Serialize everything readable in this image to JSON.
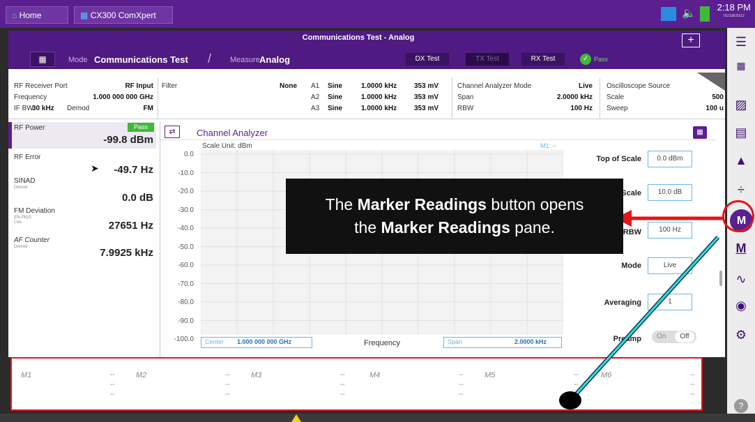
{
  "taskbar": {
    "home": "Home",
    "app": "CX300 ComXpert",
    "time": "2:18 PM",
    "date": "01/18/2022"
  },
  "header": {
    "title": "Communications Test - Analog",
    "mode_label": "Mode",
    "mode_value": "Communications Test",
    "measure_label": "Measure",
    "measure_value": "Analog",
    "tests": [
      "DX Test",
      "TX Test",
      "RX Test"
    ],
    "status": "Pass"
  },
  "info": {
    "rf_port_label": "RF Receiver Port",
    "rf_port_value": "RF Input",
    "freq_label": "Frequency",
    "freq_value": "1.000 000 000 GHz",
    "ifbw_label": "IF BW",
    "ifbw_value": "30 kHz",
    "demod_label": "Demod",
    "demod_value": "FM",
    "filter_label": "Filter",
    "filter_value": "None",
    "audio": [
      {
        "name": "A1",
        "wave": "Sine",
        "freq": "1.0000 kHz",
        "level": "353 mV"
      },
      {
        "name": "A2",
        "wave": "Sine",
        "freq": "1.0000 kHz",
        "level": "353 mV"
      },
      {
        "name": "A3",
        "wave": "Sine",
        "freq": "1.0000 kHz",
        "level": "353 mV"
      }
    ],
    "ca_mode_label": "Channel Analyzer Mode",
    "ca_mode_value": "Live",
    "span_label": "Span",
    "span_value": "2.0000 kHz",
    "rbw_label": "RBW",
    "rbw_value": "100 Hz",
    "osc_label": "Oscilloscope Source",
    "scale_label": "Scale",
    "scale_value": "500",
    "sweep_label": "Sweep",
    "sweep_value": "100 u"
  },
  "readings": [
    {
      "label": "RF Power",
      "sub": "",
      "value": "-99.8 dBm",
      "badge": "Pass"
    },
    {
      "label": "RF Error",
      "sub": "",
      "value": "-49.7 Hz"
    },
    {
      "label": "SINAD",
      "sub": "Demod",
      "value": "0.0 dB"
    },
    {
      "label": "FM Deviation",
      "sub": "(Pk-Pk)/2",
      "sub2": "Live",
      "value": "27651 Hz"
    },
    {
      "label": "AF Counter",
      "sub": "Demod",
      "value": "7.9925 kHz"
    }
  ],
  "chart": {
    "title": "Channel Analyzer",
    "scale_unit": "Scale Unit: dBm",
    "marker_tag": "M1: --",
    "y_ticks": [
      "0.0",
      "-10.0",
      "-20.0",
      "-30.0",
      "-40.0",
      "-50.0",
      "-60.0",
      "-70.0",
      "-80.0",
      "-90.0",
      "-100.0"
    ],
    "center_label": "Center",
    "center_value": "1.000 000 000 GHz",
    "x_label": "Frequency",
    "span_label": "Span",
    "span_value": "2.0000 kHz"
  },
  "controls": {
    "top_label": "Top of Scale",
    "top_value": "0.0 dBm",
    "scale_label": "Scale",
    "scale_value": "10.0 dB",
    "rbw_label": "RBW",
    "rbw_value": "100 Hz",
    "mode_label": "Mode",
    "mode_value": "Live",
    "avg_label": "Averaging",
    "avg_value": "1",
    "preamp_label": "Preamp",
    "on": "On",
    "off": "Off"
  },
  "markers": [
    "M1",
    "M2",
    "M3",
    "M4",
    "M5",
    "M6"
  ],
  "callout": {
    "l1a": "The ",
    "l1b": "Marker Readings",
    "l1c": " button opens",
    "l2a": "the ",
    "l2b": "Marker Readings",
    "l2c": " pane."
  },
  "sidebar": {
    "marker_letter": "M",
    "marker_sub": "M"
  }
}
